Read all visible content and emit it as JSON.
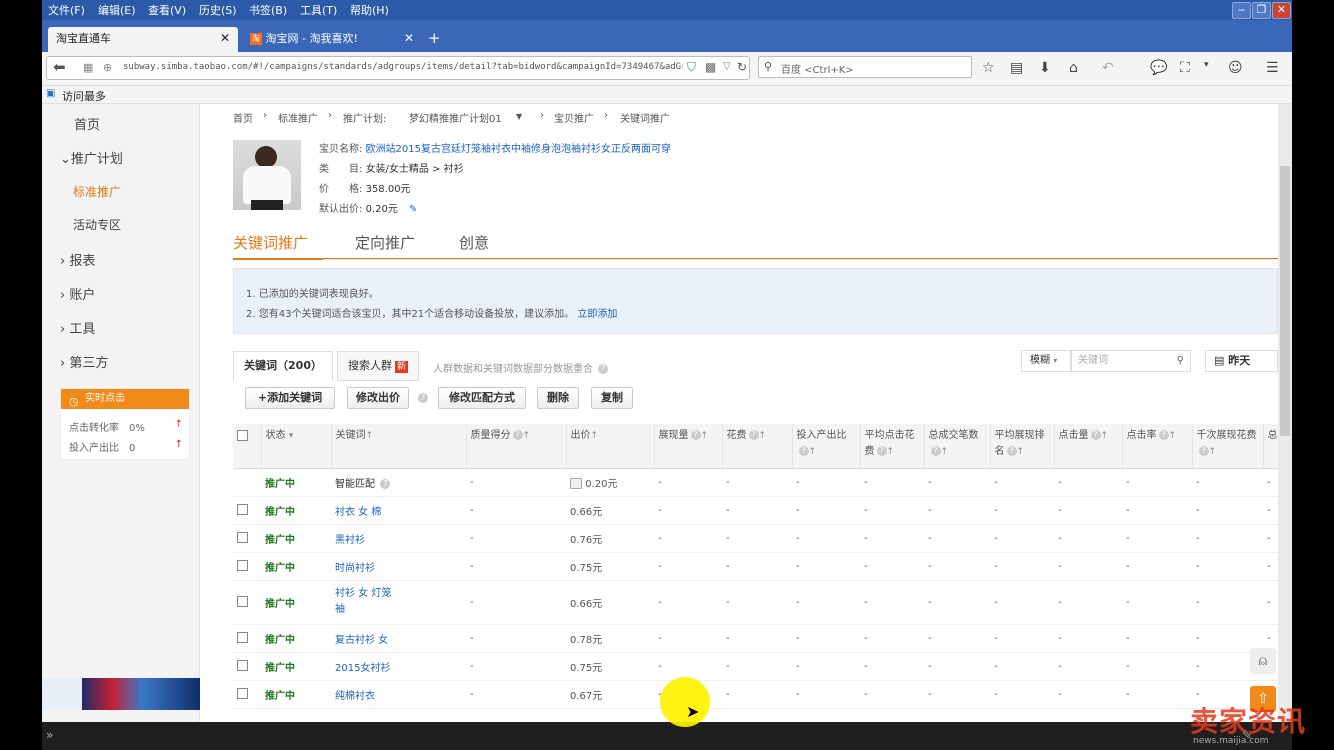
{
  "menu": [
    "文件(F)",
    "编辑(E)",
    "查看(V)",
    "历史(S)",
    "书签(B)",
    "工具(T)",
    "帮助(H)"
  ],
  "tabs": [
    {
      "label": "淘宝直通车",
      "active": true
    },
    {
      "label": "淘宝网 - 淘我喜欢!",
      "active": false
    }
  ],
  "nav": {
    "url": "subway.simba.taobao.com/#!/campaigns/standards/adgroups/items/detail?tab=bidword&campaignId=7349467&adGroup",
    "search_placeholder": "百度 <Ctrl+K>"
  },
  "bookmarks": {
    "most_visited": "访问最多"
  },
  "sidebar": {
    "home": "首页",
    "plan": "推广计划",
    "standard": "标准推广",
    "activity": "活动专区",
    "report": "报表",
    "account": "账户",
    "tools": "工具",
    "third": "第三方",
    "realtime": {
      "title": "实时点击",
      "cvr_label": "点击转化率",
      "cvr_value": "0%",
      "roi_label": "投入产出比",
      "roi_value": "0"
    }
  },
  "breadcrumb": {
    "home": "首页",
    "standard": "标准推广",
    "plan_prefix": "推广计划:",
    "plan_name": "梦幻精推推广计划01",
    "item": "宝贝推广",
    "current": "关键词推广"
  },
  "product": {
    "name_label": "宝贝名称:",
    "name": "欧洲站2015复古宫廷灯笼袖衬衣中袖修身泡泡袖衬衫女正反两面可穿",
    "category_label": "类　　目:",
    "category": "女装/女士精品 > 衬衫",
    "price_label": "价　　格:",
    "price": "358.00元",
    "default_bid_label": "默认出价:",
    "default_bid": "0.20元"
  },
  "page_tabs": [
    "关键词推广",
    "定向推广",
    "创意"
  ],
  "tips": {
    "line1": "1. 已添加的关键词表现良好。",
    "line2": "2. 您有43个关键词适合该宝贝，其中21个适合移动设备投放，建议添加。",
    "add_link": "立即添加"
  },
  "kw_tabs": {
    "keywords": "关键词（200）",
    "crowd": "搜索人群",
    "new_badge": "新",
    "note": "人群数据和关键词数据部分数据重合"
  },
  "filter": {
    "mode": "模糊",
    "placeholder": "关键词",
    "date": "昨天"
  },
  "buttons": {
    "add": "添加关键词",
    "edit_bid": "修改出价",
    "edit_match": "修改匹配方式",
    "delete": "删除",
    "copy": "复制"
  },
  "columns": [
    "状态",
    "关键词",
    "质量得分",
    "出价",
    "展现量",
    "花费",
    "投入产出比",
    "平均点击花费",
    "总成交笔数",
    "平均展现排名",
    "点击量",
    "点击率",
    "千次展现花费",
    "总"
  ],
  "rows": [
    {
      "status": "推广中",
      "keyword": "智能匹配",
      "score": "-",
      "bid": "0.20元",
      "smart": true
    },
    {
      "status": "推广中",
      "keyword": "衬衣 女 棉",
      "score": "-",
      "bid": "0.66元"
    },
    {
      "status": "推广中",
      "keyword": "黑衬衫",
      "score": "-",
      "bid": "0.76元"
    },
    {
      "status": "推广中",
      "keyword": "时尚衬衫",
      "score": "-",
      "bid": "0.75元"
    },
    {
      "status": "推广中",
      "keyword": "衬衫 女 灯笼袖",
      "score": "-",
      "bid": "0.66元"
    },
    {
      "status": "推广中",
      "keyword": "复古衬衫 女",
      "score": "-",
      "bid": "0.78元"
    },
    {
      "status": "推广中",
      "keyword": "2015女衬衫",
      "score": "-",
      "bid": "0.75元"
    },
    {
      "status": "推广中",
      "keyword": "纯棉衬衣",
      "score": "-",
      "bid": "0.67元"
    }
  ],
  "dash": "-",
  "watermark": {
    "main": "卖家资讯",
    "sub": "news.maijia.com"
  }
}
